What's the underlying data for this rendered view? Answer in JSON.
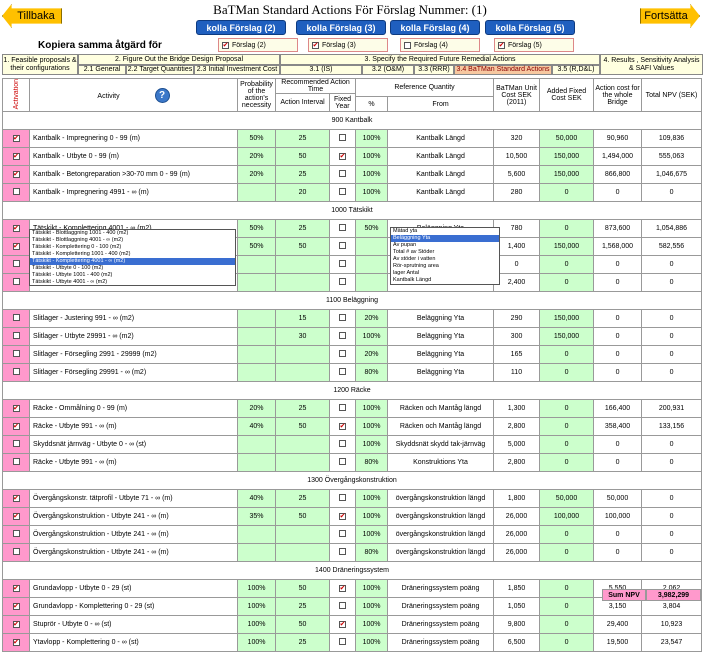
{
  "title": "BaTMan Standard Actions För Förslag Nummer: (1)",
  "nav_back": "Tillbaka",
  "nav_next": "Fortsätta",
  "kolla_buttons": [
    "kolla Förslag (2)",
    "kolla Förslag (3)",
    "kolla Förslag (4)",
    "kolla Förslag (5)"
  ],
  "copy_label": "Kopiera samma åtgärd för",
  "forslag_boxes": [
    {
      "label": "Förslag (2)",
      "checked": true
    },
    {
      "label": "Förslag (3)",
      "checked": true
    },
    {
      "label": "Förslag (4)",
      "checked": false
    },
    {
      "label": "Förslag (5)",
      "checked": true
    }
  ],
  "steps": {
    "s1": "1. Feasible proposals & their configurations",
    "s2": "2. Figure Out the Bridge Design Proposal",
    "s21": "2.1 General",
    "s22": "2.2 Target Quantities",
    "s23": "2.3 Initial Investment Cost",
    "s3": "3. Specify the Required Future Remedial Actions",
    "s31": "3.1 (IS)",
    "s32": "3.2 (O&M)",
    "s33": "3.3 (RRR)",
    "s34": "3.4 BaTMan Standard Actions",
    "s35": "3.5 (R,D&L)",
    "s4": "4. Results , Sensitivity Analysis & SAFI Values"
  },
  "columns": {
    "activation": "Activation",
    "activity": "Activity",
    "help": "?",
    "probability": "Probability of the action's necessity",
    "recommended": "Recommended Action Time",
    "interval": "Action Interval",
    "fixed": "Fixed Year",
    "refq": "Reference Quantity",
    "pct": "%",
    "from": "From",
    "unitcost": "BaTMan Unit Cost SEK (2011)",
    "fixedcost": "Added Fixed Cost SEK",
    "actioncost": "Action cost for the whole Bridge",
    "npv": "Total NPV (SEK)"
  },
  "sections": [
    {
      "name": "900 Kantbalk",
      "rows": [
        {
          "on": true,
          "act": "Kantbalk - Impregnering 0 - 99 (m)",
          "prob": "50%",
          "int": "25",
          "fix": false,
          "pct": "100%",
          "from": "Kantbalk Längd",
          "unit": "320",
          "fc": "50,000",
          "ac": "90,960",
          "npv": "109,836"
        },
        {
          "on": true,
          "act": "Kantbalk - Utbyte 0 - 99 (m)",
          "prob": "20%",
          "int": "50",
          "fix": true,
          "pct": "100%",
          "from": "Kantbalk Längd",
          "unit": "10,500",
          "fc": "150,000",
          "ac": "1,494,000",
          "npv": "555,063"
        },
        {
          "on": true,
          "act": "Kantbalk - Betongreparation >30-70 mm 0 - 99 (m)",
          "prob": "20%",
          "int": "25",
          "fix": false,
          "pct": "100%",
          "from": "Kantbalk Längd",
          "unit": "5,600",
          "fc": "150,000",
          "ac": "866,800",
          "npv": "1,046,675"
        },
        {
          "on": false,
          "act": "Kantbalk - Impregnering 4991 - ∞ (m)",
          "prob": "",
          "int": "20",
          "fix": false,
          "pct": "100%",
          "from": "Kantbalk Längd",
          "unit": "280",
          "fc": "0",
          "ac": "0",
          "npv": "0"
        }
      ]
    },
    {
      "name": "1000 Tätskikt",
      "rows": [
        {
          "on": true,
          "act": "Tätskikt - Komplettering 4001 - ∞ (m2)",
          "prob": "50%",
          "int": "25",
          "fix": false,
          "pct": "50%",
          "from": "Beläggning Yta",
          "unit": "780",
          "fc": "0",
          "ac": "873,600",
          "npv": "1,054,886"
        },
        {
          "on": true,
          "act": "",
          "prob": "50%",
          "int": "50",
          "fix": false,
          "pct": "",
          "from": "",
          "unit": "1,400",
          "fc": "150,000",
          "ac": "1,568,000",
          "npv": "582,556"
        },
        {
          "on": false,
          "act": "",
          "prob": "",
          "int": "",
          "fix": false,
          "pct": "",
          "from": "",
          "unit": "0",
          "fc": "0",
          "ac": "0",
          "npv": "0"
        },
        {
          "on": false,
          "act": "",
          "prob": "",
          "int": "",
          "fix": false,
          "pct": "",
          "from": "",
          "unit": "2,400",
          "fc": "0",
          "ac": "0",
          "npv": "0"
        }
      ]
    },
    {
      "name": "1100 Beläggning",
      "rows": [
        {
          "on": false,
          "act": "Slitlager - Justering 991 - ∞ (m2)",
          "prob": "",
          "int": "15",
          "fix": false,
          "pct": "20%",
          "from": "Beläggning Yta",
          "unit": "290",
          "fc": "150,000",
          "ac": "0",
          "npv": "0"
        },
        {
          "on": false,
          "act": "Slitlager - Utbyte 29991 - ∞ (m2)",
          "prob": "",
          "int": "30",
          "fix": false,
          "pct": "100%",
          "from": "Beläggning Yta",
          "unit": "300",
          "fc": "150,000",
          "ac": "0",
          "npv": "0"
        },
        {
          "on": false,
          "act": "Slitlager - Försegling 2991 - 29999 (m2)",
          "prob": "",
          "int": "",
          "fix": false,
          "pct": "20%",
          "from": "Beläggning Yta",
          "unit": "165",
          "fc": "0",
          "ac": "0",
          "npv": "0"
        },
        {
          "on": false,
          "act": "Slitlager - Försegling 29991 - ∞ (m2)",
          "prob": "",
          "int": "",
          "fix": false,
          "pct": "80%",
          "from": "Beläggning Yta",
          "unit": "110",
          "fc": "0",
          "ac": "0",
          "npv": "0"
        }
      ]
    },
    {
      "name": "1200 Räcke",
      "rows": [
        {
          "on": true,
          "act": "Räcke - Ommålning 0 - 99 (m)",
          "prob": "20%",
          "int": "25",
          "fix": false,
          "pct": "100%",
          "from": "Räcken och Mantåg längd",
          "unit": "1,300",
          "fc": "0",
          "ac": "166,400",
          "npv": "200,931"
        },
        {
          "on": true,
          "act": "Räcke - Utbyte 991 - ∞ (m)",
          "prob": "40%",
          "int": "50",
          "fix": true,
          "pct": "100%",
          "from": "Räcken och Mantåg längd",
          "unit": "2,800",
          "fc": "0",
          "ac": "358,400",
          "npv": "133,156"
        },
        {
          "on": false,
          "act": "Skyddsnät järnväg - Utbyte 0 - ∞ (st)",
          "prob": "",
          "int": "",
          "fix": false,
          "pct": "100%",
          "from": "Skyddsnät skydd tak-järnväg",
          "unit": "5,000",
          "fc": "0",
          "ac": "0",
          "npv": "0"
        },
        {
          "on": false,
          "act": "Räcke - Utbyte 991 - ∞ (m)",
          "prob": "",
          "int": "",
          "fix": false,
          "pct": "80%",
          "from": "Konstruktions Yta",
          "unit": "2,800",
          "fc": "0",
          "ac": "0",
          "npv": "0"
        }
      ]
    },
    {
      "name": "1300 Övergångskonstruktion",
      "rows": [
        {
          "on": true,
          "act": "Övergångskonstr. tätprofil - Utbyte 71 - ∞ (m)",
          "prob": "40%",
          "int": "25",
          "fix": false,
          "pct": "100%",
          "from": "övergångskonstruktion längd",
          "unit": "1,800",
          "fc": "50,000",
          "ac": "50,000",
          "npv": "0"
        },
        {
          "on": true,
          "act": "Övergångskonstruktion - Utbyte 241 - ∞ (m)",
          "prob": "35%",
          "int": "50",
          "fix": true,
          "pct": "100%",
          "from": "övergångskonstruktion längd",
          "unit": "26,000",
          "fc": "100,000",
          "ac": "100,000",
          "npv": "0"
        },
        {
          "on": false,
          "act": "Övergångskonstruktion - Utbyte 241 - ∞ (m)",
          "prob": "",
          "int": "",
          "fix": false,
          "pct": "100%",
          "from": "övergångskonstruktion längd",
          "unit": "26,000",
          "fc": "0",
          "ac": "0",
          "npv": "0"
        },
        {
          "on": false,
          "act": "Övergångskonstruktion - Utbyte 241 - ∞ (m)",
          "prob": "",
          "int": "",
          "fix": false,
          "pct": "80%",
          "from": "övergångskonstruktion längd",
          "unit": "26,000",
          "fc": "0",
          "ac": "0",
          "npv": "0"
        }
      ]
    },
    {
      "name": "1400 Dräneringssystem",
      "rows": [
        {
          "on": true,
          "act": "Grundavlopp - Utbyte 0 - 29 (st)",
          "prob": "100%",
          "int": "50",
          "fix": true,
          "pct": "100%",
          "from": "Dräneringssystem poäng",
          "unit": "1,850",
          "fc": "0",
          "ac": "5,550",
          "npv": "2,062"
        },
        {
          "on": true,
          "act": "Grundavlopp - Komplettering 0 - 29 (st)",
          "prob": "100%",
          "int": "25",
          "fix": false,
          "pct": "100%",
          "from": "Dräneringssystem poäng",
          "unit": "1,050",
          "fc": "0",
          "ac": "3,150",
          "npv": "3,804"
        },
        {
          "on": true,
          "act": "Stuprör - Utbyte 0 - ∞ (st)",
          "prob": "100%",
          "int": "50",
          "fix": true,
          "pct": "100%",
          "from": "Dräneringssystem poäng",
          "unit": "9,800",
          "fc": "0",
          "ac": "29,400",
          "npv": "10,923"
        },
        {
          "on": true,
          "act": "Ytavlopp - Komplettering 0 - ∞ (st)",
          "prob": "100%",
          "int": "25",
          "fix": false,
          "pct": "100%",
          "from": "Dräneringssystem poäng",
          "unit": "6,500",
          "fc": "0",
          "ac": "19,500",
          "npv": "23,547"
        }
      ]
    }
  ],
  "dropdown_activity": {
    "options": [
      "Tätskikt - Blottlaggning 1001 - 400 (m2)",
      "Tätskikt - Blottlaggning 4001 - ∞ (m2)",
      "Tätskikt - Komplettering 0 - 100 (m2)",
      "Tätskikt - Komplettering 1001 - 400 (m2)",
      "Tätskikt - Komplettering 4001 - ∞ (m2)",
      "Tätskikt - Utbyte 0 - 100 (m2)",
      "Tätskikt - Utbyte 1001 - 400 (m2)",
      "Tätskikt - Utbyte 4001 - ∞ (m2)"
    ],
    "selected": 4
  },
  "dropdown_from": {
    "options": [
      "Mätad yta",
      "Beläggning Yta",
      "Av pupan",
      "Total # av Stöder",
      "Av stöder i vatten",
      "Rör-sprutning area",
      "lager Antal",
      "Kantbalk Längd"
    ],
    "selected": 1
  },
  "sum_label": "Sum NPV",
  "sum_value": "3,982,299",
  "colors": {
    "accent": "#1f5fbf",
    "activation": "#ff99cc",
    "input": "#ccffcc",
    "arrow": "#ffc000"
  }
}
